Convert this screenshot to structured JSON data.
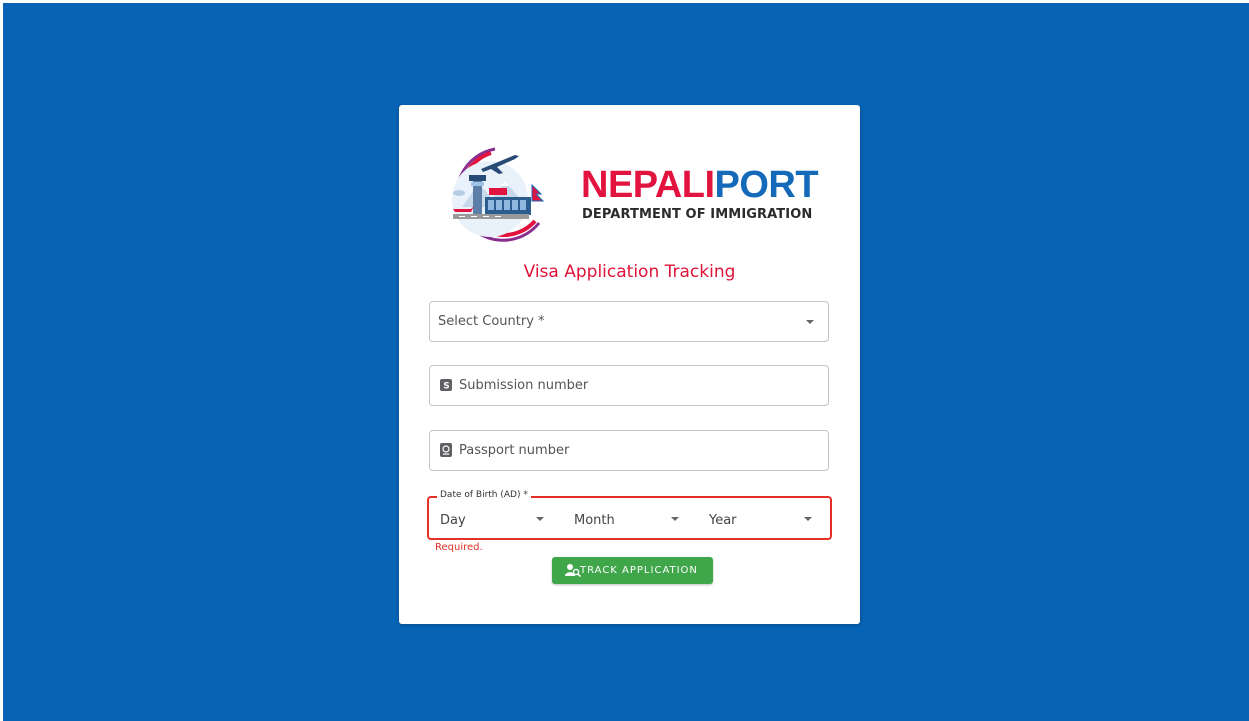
{
  "brand": {
    "name_part1": "NEPALI",
    "name_part2": "PORT",
    "subtitle": "DEPARTMENT OF IMMIGRATION",
    "colors": {
      "red": "#e2133f",
      "blue": "#1469b8"
    }
  },
  "form": {
    "title": "Visa Application Tracking",
    "country": {
      "placeholder": "Select Country *",
      "icon": "chevron-down-icon"
    },
    "submission": {
      "placeholder": "Submission number",
      "icon": "submission-s-icon"
    },
    "passport": {
      "placeholder": "Passport number",
      "icon": "passport-icon"
    },
    "dob": {
      "legend": "Date of Birth (AD) *",
      "day": "Day",
      "month": "Month",
      "year": "Year",
      "error": "Required."
    },
    "submit": {
      "label": "TRACK APPLICATION",
      "icon": "user-search-icon"
    }
  },
  "colors": {
    "background": "#0763b3",
    "error": "#e53125",
    "button": "#3fa74a"
  }
}
